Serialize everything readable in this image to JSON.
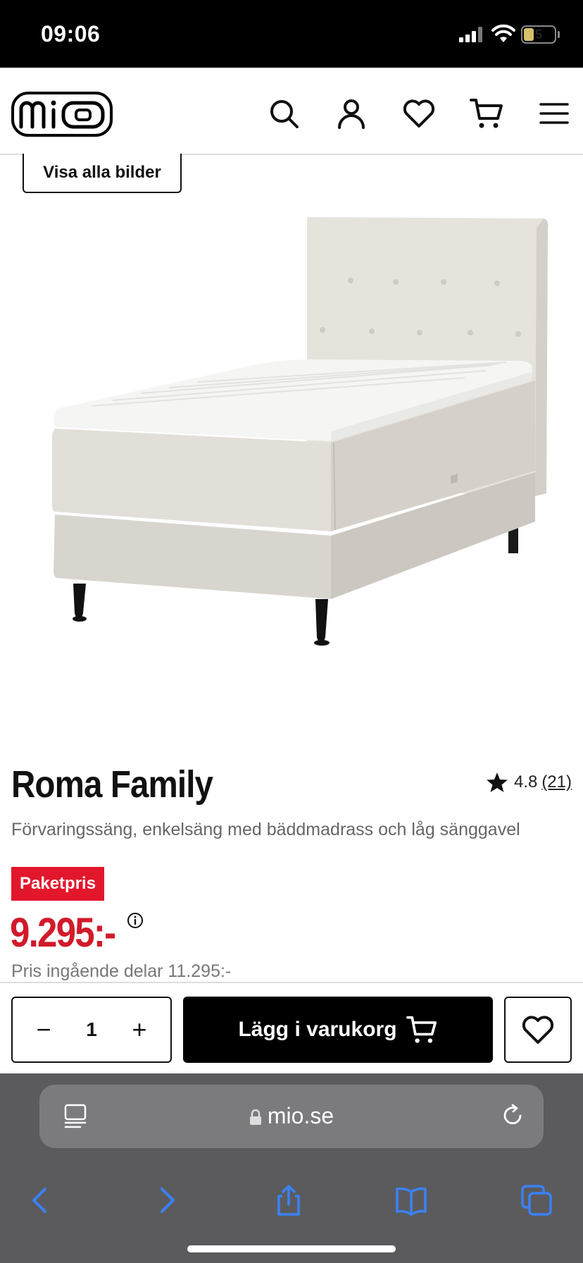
{
  "status_bar": {
    "time": "09:06",
    "battery": "5"
  },
  "header": {
    "logo_text": "mio",
    "icons": [
      "search-icon",
      "user-icon",
      "heart-icon",
      "cart-icon",
      "menu-icon"
    ]
  },
  "gallery": {
    "view_all_label": "Visa alla bilder"
  },
  "product": {
    "title": "Roma Family",
    "rating": "4.8",
    "review_count": "(21)",
    "subtitle": "Förvaringssäng, enkelsäng med bäddmadrass och låg sänggavel",
    "badge": "Paketpris",
    "price": "9.295:-",
    "original_price": "Pris ingående delar 11.295:-"
  },
  "actions": {
    "quantity": "1",
    "minus": "−",
    "plus": "+",
    "add_to_cart": "Lägg i varukorg"
  },
  "browser": {
    "url": "mio.se"
  },
  "colors": {
    "brand_red": "#e3172c",
    "price_red": "#d11a2a",
    "ios_blue": "#3a82f7"
  }
}
